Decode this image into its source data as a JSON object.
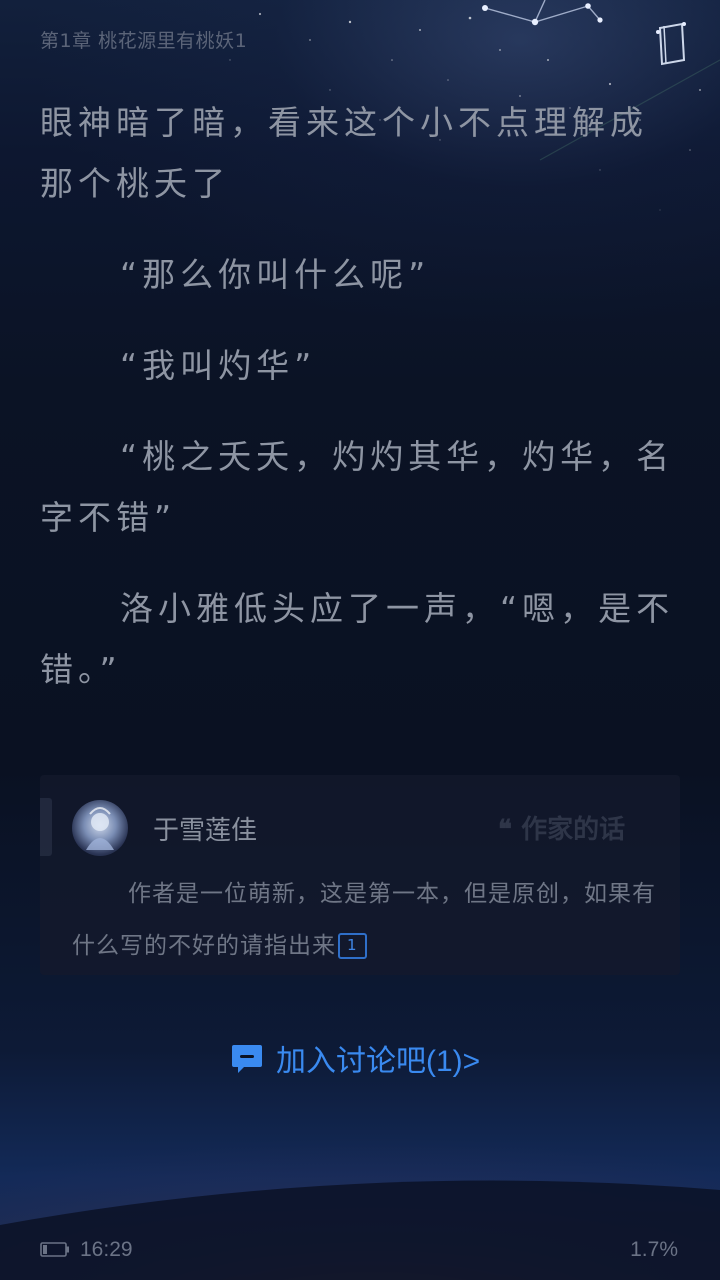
{
  "header": {
    "chapter_title": "第1章 桃花源里有桃妖1"
  },
  "content": {
    "paragraphs": [
      "眼神暗了暗，看来这个小不点理解成那个桃夭了",
      "“那么你叫什么呢”",
      "“我叫灼华”",
      "“桃之夭夭，灼灼其华，灼华，名字不错”",
      "洛小雅低头应了一声，“嗯，是不错。”"
    ]
  },
  "author_card": {
    "author_name": "于雪莲佳",
    "label": "作家的话",
    "note": "作者是一位萌新，这是第一本，但是原创，如果有什么写的不好的请指出来",
    "comment_count": "1"
  },
  "discuss": {
    "label": "加入讨论吧(1)>"
  },
  "status": {
    "time": "16:29",
    "progress": "1.7%"
  },
  "icons": {
    "quote": "quote-icon",
    "chat": "chat-bubble-icon",
    "battery": "battery-icon",
    "book": "book-icon"
  },
  "colors": {
    "accent": "#3a8af0",
    "text": "#8e95a3",
    "background": "#0b1020"
  }
}
